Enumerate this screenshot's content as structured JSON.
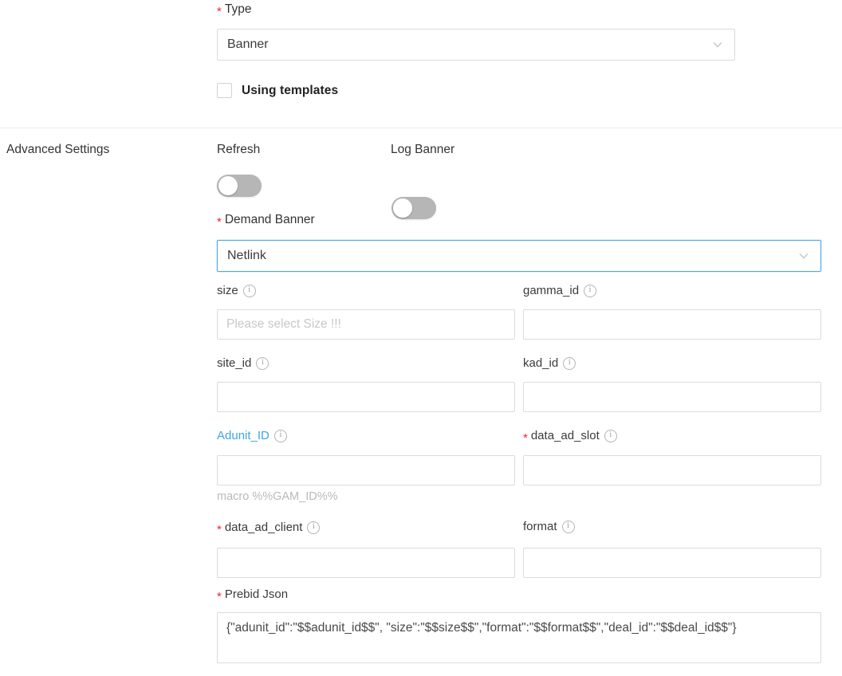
{
  "form": {
    "type": {
      "label": "Type",
      "required": true,
      "value": "Banner"
    },
    "using_templates": {
      "label": "Using templates",
      "checked": false
    }
  },
  "advanced_settings": {
    "section_title": "Advanced Settings",
    "refresh": {
      "label": "Refresh",
      "enabled": false
    },
    "log_banner": {
      "label": "Log Banner",
      "enabled": false
    },
    "demand_banner": {
      "label": "Demand Banner",
      "required": true,
      "value": "Netlink",
      "focused": true
    },
    "fields": {
      "size": {
        "label": "size",
        "required": false,
        "value": "",
        "placeholder": "Please select Size !!!",
        "info": true
      },
      "gamma_id": {
        "label": "gamma_id",
        "required": false,
        "value": "",
        "placeholder": "",
        "info": true
      },
      "site_id": {
        "label": "site_id",
        "required": false,
        "value": "",
        "placeholder": "",
        "info": true
      },
      "kad_id": {
        "label": "kad_id",
        "required": false,
        "value": "",
        "placeholder": "",
        "info": true
      },
      "adunit_id": {
        "label": "Adunit_ID",
        "required": false,
        "value": "",
        "placeholder": "",
        "info": true,
        "is_link": true,
        "hint": "macro %%GAM_ID%%"
      },
      "data_ad_slot": {
        "label": "data_ad_slot",
        "required": true,
        "value": "",
        "placeholder": "",
        "info": true
      },
      "data_ad_client": {
        "label": "data_ad_client",
        "required": true,
        "value": "",
        "placeholder": "",
        "info": true
      },
      "format": {
        "label": "format",
        "required": false,
        "value": "",
        "placeholder": "",
        "info": true
      },
      "prebid_json": {
        "label": "Prebid Json",
        "required": true,
        "value": "{\"adunit_id\":\"$$adunit_id$$\", \"size\":\"$$size$$\",\"format\":\"$$format$$\",\"deal_id\":\"$$deal_id$$\"}",
        "placeholder": ""
      }
    }
  },
  "icons": {
    "chevron_down": "chevron-down-icon",
    "info": "info-circle-icon"
  },
  "colors": {
    "required_star": "#f5222d",
    "link": "#40a4e8",
    "focus_border": "#4aa8e8",
    "toggle_off": "#b6b6b6",
    "border": "#dcdcdc"
  }
}
